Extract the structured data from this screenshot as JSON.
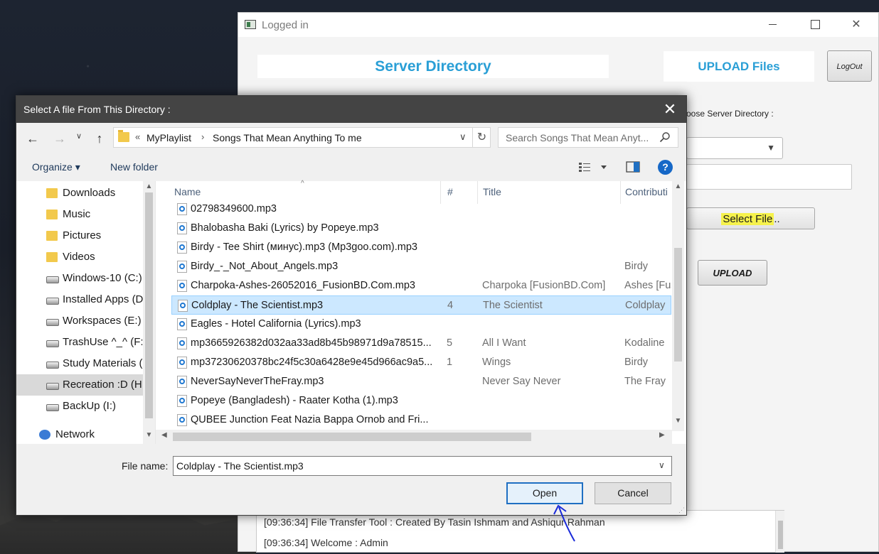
{
  "app": {
    "title": "Logged in",
    "server_directory": "Server Directory",
    "upload_files": "UPLOAD Files",
    "logout": "LogOut",
    "choose_dir_label": "oose Server Directory :",
    "select_file": "Select File",
    "select_file_suffix": "..",
    "upload": "UPLOAD",
    "log": [
      "[09:36:34]  File Transfer Tool : Created By Tasin Ishmam and Ashiqur Rahman",
      "[09:36:34]  Welcome : Admin"
    ]
  },
  "dialog": {
    "title": "Select A file From This Directory :",
    "address": {
      "overflow": "«",
      "segment1": "MyPlaylist",
      "separator": "›",
      "segment2": "Songs That Mean Anything To me"
    },
    "search_placeholder": "Search Songs That Mean Anyt...",
    "toolbar": {
      "organize": "Organize ▾",
      "new_folder": "New folder"
    },
    "nav_items": [
      {
        "label": "Downloads",
        "icon": "downloads-folder-icon"
      },
      {
        "label": "Music",
        "icon": "music-folder-icon"
      },
      {
        "label": "Pictures",
        "icon": "pictures-folder-icon"
      },
      {
        "label": "Videos",
        "icon": "videos-folder-icon"
      },
      {
        "label": "Windows-10 (C:)",
        "icon": "windows-drive-icon"
      },
      {
        "label": "Installed Apps (D",
        "icon": "drive-icon"
      },
      {
        "label": "Workspaces (E:)",
        "icon": "drive-icon"
      },
      {
        "label": "TrashUse ^_^ (F:)",
        "icon": "drive-icon"
      },
      {
        "label": "Study Materials (",
        "icon": "drive-icon"
      },
      {
        "label": "Recreation :D (H",
        "icon": "drive-icon",
        "selected": true
      },
      {
        "label": "BackUp (I:)",
        "icon": "drive-icon"
      },
      {
        "label": "Network",
        "icon": "network-icon"
      }
    ],
    "columns": {
      "name": "Name",
      "num": "#",
      "title": "Title",
      "contrib": "Contributi"
    },
    "files": [
      {
        "name": "02798349600.mp3",
        "num": "",
        "title": "",
        "contrib": ""
      },
      {
        "name": "Bhalobasha Baki (Lyrics) by Popeye.mp3",
        "num": "",
        "title": "",
        "contrib": ""
      },
      {
        "name": "Birdy - Tee Shirt (минус).mp3 (Mp3goo.com).mp3",
        "num": "",
        "title": "",
        "contrib": ""
      },
      {
        "name": "Birdy_-_Not_About_Angels.mp3",
        "num": "",
        "title": "",
        "contrib": "Birdy"
      },
      {
        "name": "Charpoka-Ashes-26052016_FusionBD.Com.mp3",
        "num": "",
        "title": "Charpoka [FusionBD.Com]",
        "contrib": "Ashes [Fus"
      },
      {
        "name": "Coldplay - The Scientist.mp3",
        "num": "4",
        "title": "The Scientist",
        "contrib": "Coldplay",
        "selected": true
      },
      {
        "name": "Eagles - Hotel California (Lyrics).mp3",
        "num": "",
        "title": "",
        "contrib": ""
      },
      {
        "name": "mp3665926382d032aa33ad8b45b98971d9a78515...",
        "num": "5",
        "title": "All I Want",
        "contrib": "Kodaline"
      },
      {
        "name": "mp37230620378bc24f5c30a6428e9e45d966ac9a5...",
        "num": "1",
        "title": "Wings",
        "contrib": "Birdy"
      },
      {
        "name": "NeverSayNeverTheFray.mp3",
        "num": "",
        "title": "Never Say Never",
        "contrib": "The Fray"
      },
      {
        "name": "Popeye (Bangladesh) - Raater Kotha (1).mp3",
        "num": "",
        "title": "",
        "contrib": ""
      },
      {
        "name": "QUBEE Junction Feat  Nazia Bappa Ornob and Fri...",
        "num": "",
        "title": "",
        "contrib": ""
      }
    ],
    "filename_label": "File name:",
    "filename_value": "Coldplay - The Scientist.mp3",
    "open": "Open",
    "cancel": "Cancel"
  },
  "colors": {
    "accent": "#2a9fd6",
    "dialog_titlebar": "#444444",
    "selection": "#cce8ff",
    "highlight": "#f6f24b"
  }
}
